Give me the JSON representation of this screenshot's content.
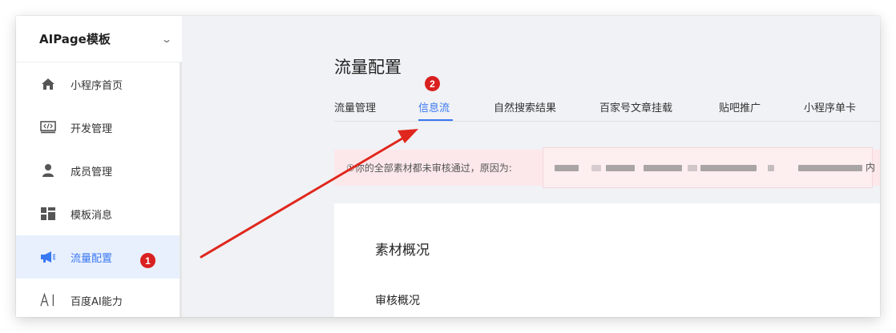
{
  "sidebar": {
    "app_title": "AIPage模板",
    "items": [
      {
        "label": "小程序首页",
        "icon": "home-icon"
      },
      {
        "label": "开发管理",
        "icon": "code-icon"
      },
      {
        "label": "成员管理",
        "icon": "user-icon"
      },
      {
        "label": "模板消息",
        "icon": "template-icon"
      },
      {
        "label": "流量配置",
        "icon": "megaphone-icon",
        "active": true
      },
      {
        "label": "百度AI能力",
        "icon": "ai-icon"
      }
    ]
  },
  "main": {
    "page_title": "流量配置",
    "tabs": [
      {
        "label": "流量管理"
      },
      {
        "label": "信息流",
        "active": true
      },
      {
        "label": "自然搜索结果"
      },
      {
        "label": "百家号文章挂载"
      },
      {
        "label": "贴吧推广"
      },
      {
        "label": "小程序单卡"
      }
    ],
    "alert": {
      "text": "①你的全部素材都未审核通过，原因为:",
      "trailing_char": "内"
    },
    "card": {
      "title": "素材概况",
      "subtitle": "审核概况"
    }
  },
  "annotations": {
    "badge_1": "1",
    "badge_2": "2"
  },
  "colors": {
    "accent": "#3a78f2",
    "badge": "#d92020",
    "alert_bg": "#fce8ea",
    "arrow": "#e0271d"
  }
}
